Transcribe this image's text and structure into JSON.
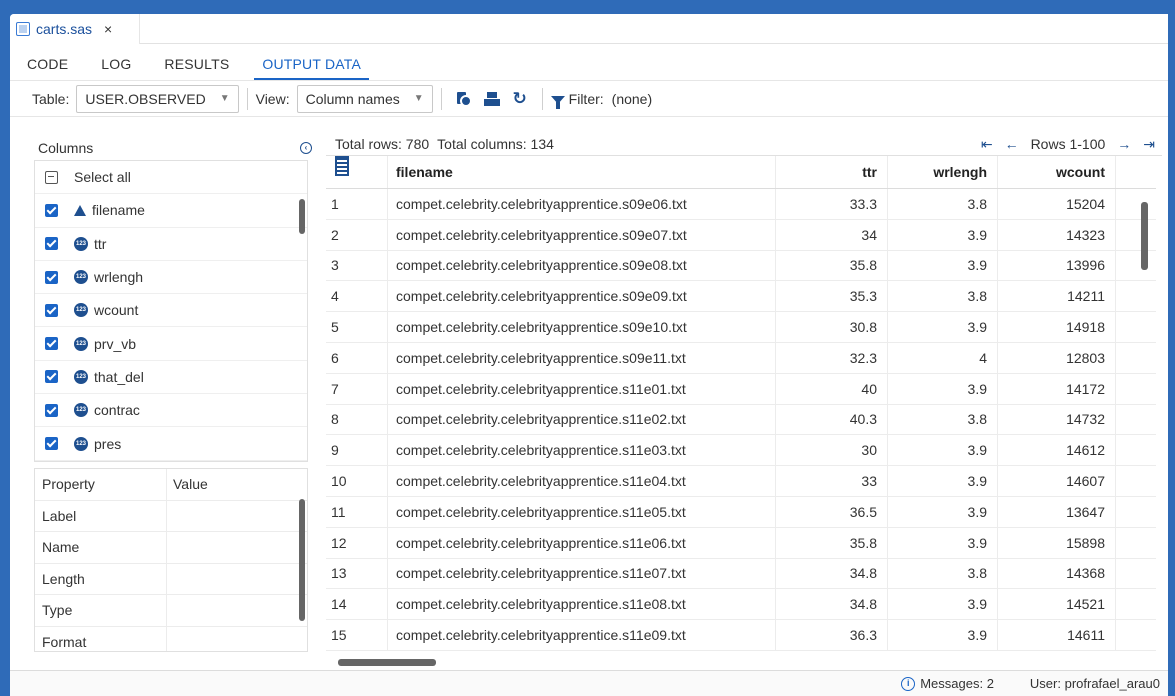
{
  "file_tab": {
    "name": "carts.sas",
    "close": "×"
  },
  "view_tabs": [
    {
      "label": "CODE"
    },
    {
      "label": "LOG"
    },
    {
      "label": "RESULTS"
    },
    {
      "label": "OUTPUT DATA",
      "active": true
    }
  ],
  "toolbar": {
    "table_label": "Table:",
    "table_value": "USER.OBSERVED",
    "view_label": "View:",
    "view_value": "Column names",
    "filter_label": "Filter:",
    "filter_value": "(none)"
  },
  "columns_panel": {
    "title": "Columns",
    "select_all": "Select all",
    "items": [
      {
        "label": "filename",
        "type": "char"
      },
      {
        "label": "ttr",
        "type": "num"
      },
      {
        "label": "wrlengh",
        "type": "num"
      },
      {
        "label": "wcount",
        "type": "num"
      },
      {
        "label": "prv_vb",
        "type": "num"
      },
      {
        "label": "that_del",
        "type": "num"
      },
      {
        "label": "contrac",
        "type": "num"
      },
      {
        "label": "pres",
        "type": "num"
      }
    ]
  },
  "property_panel": {
    "header_property": "Property",
    "header_value": "Value",
    "rows": [
      "Label",
      "Name",
      "Length",
      "Type",
      "Format"
    ]
  },
  "grid_info": {
    "total_rows": "Total rows: 780",
    "total_columns": "Total columns: 134",
    "rows_range": "Rows 1-100"
  },
  "grid": {
    "headers": {
      "idx": "",
      "filename": "filename",
      "ttr": "ttr",
      "wrlengh": "wrlengh",
      "wcount": "wcount"
    },
    "rows": [
      [
        "1",
        "compet.celebrity.celebrityapprentice.s09e06.txt",
        "33.3",
        "3.8",
        "15204"
      ],
      [
        "2",
        "compet.celebrity.celebrityapprentice.s09e07.txt",
        "34",
        "3.9",
        "14323"
      ],
      [
        "3",
        "compet.celebrity.celebrityapprentice.s09e08.txt",
        "35.8",
        "3.9",
        "13996"
      ],
      [
        "4",
        "compet.celebrity.celebrityapprentice.s09e09.txt",
        "35.3",
        "3.8",
        "14211"
      ],
      [
        "5",
        "compet.celebrity.celebrityapprentice.s09e10.txt",
        "30.8",
        "3.9",
        "14918"
      ],
      [
        "6",
        "compet.celebrity.celebrityapprentice.s09e11.txt",
        "32.3",
        "4",
        "12803"
      ],
      [
        "7",
        "compet.celebrity.celebrityapprentice.s11e01.txt",
        "40",
        "3.9",
        "14172"
      ],
      [
        "8",
        "compet.celebrity.celebrityapprentice.s11e02.txt",
        "40.3",
        "3.8",
        "14732"
      ],
      [
        "9",
        "compet.celebrity.celebrityapprentice.s11e03.txt",
        "30",
        "3.9",
        "14612"
      ],
      [
        "10",
        "compet.celebrity.celebrityapprentice.s11e04.txt",
        "33",
        "3.9",
        "14607"
      ],
      [
        "11",
        "compet.celebrity.celebrityapprentice.s11e05.txt",
        "36.5",
        "3.9",
        "13647"
      ],
      [
        "12",
        "compet.celebrity.celebrityapprentice.s11e06.txt",
        "35.8",
        "3.9",
        "15898"
      ],
      [
        "13",
        "compet.celebrity.celebrityapprentice.s11e07.txt",
        "34.8",
        "3.8",
        "14368"
      ],
      [
        "14",
        "compet.celebrity.celebrityapprentice.s11e08.txt",
        "34.8",
        "3.9",
        "14521"
      ],
      [
        "15",
        "compet.celebrity.celebrityapprentice.s11e09.txt",
        "36.3",
        "3.9",
        "14611"
      ]
    ]
  },
  "status": {
    "messages": "Messages: 2",
    "user": "User: profrafael_arau0"
  },
  "colors": {
    "accent": "#1a64c6",
    "icon": "#1e4f8f",
    "frame": "#2f6bb8"
  }
}
